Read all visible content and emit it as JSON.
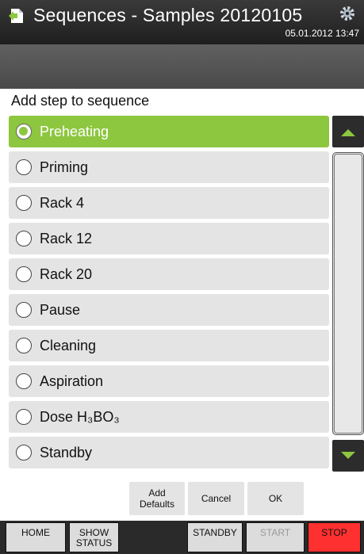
{
  "header": {
    "title": "Sequences - Samples 20120105",
    "datetime": "05.01.2012 13:47",
    "app_icon": "document-arrow-icon",
    "settings_icon": "gear-icon"
  },
  "heading": "Add step to sequence",
  "list": {
    "selected_index": 0,
    "items": [
      {
        "label": "Preheating"
      },
      {
        "label": "Priming"
      },
      {
        "label": "Rack 4"
      },
      {
        "label": "Rack 12"
      },
      {
        "label": "Rack 20"
      },
      {
        "label": "Pause"
      },
      {
        "label": "Cleaning"
      },
      {
        "label": "Aspiration"
      },
      {
        "label": "Dose H₃BO₃"
      },
      {
        "label": "Standby"
      }
    ]
  },
  "actions": {
    "add_defaults_line1": "Add",
    "add_defaults_line2": "Defaults",
    "cancel": "Cancel",
    "ok": "OK"
  },
  "footer": {
    "home": "HOME",
    "show_status_line1": "SHOW",
    "show_status_line2": "STATUS",
    "standby": "STANDBY",
    "start": "START",
    "stop": "STOP"
  },
  "colors": {
    "selected": "#8dc63f",
    "stop": "#ff3030",
    "header": "#2a2a2a"
  }
}
